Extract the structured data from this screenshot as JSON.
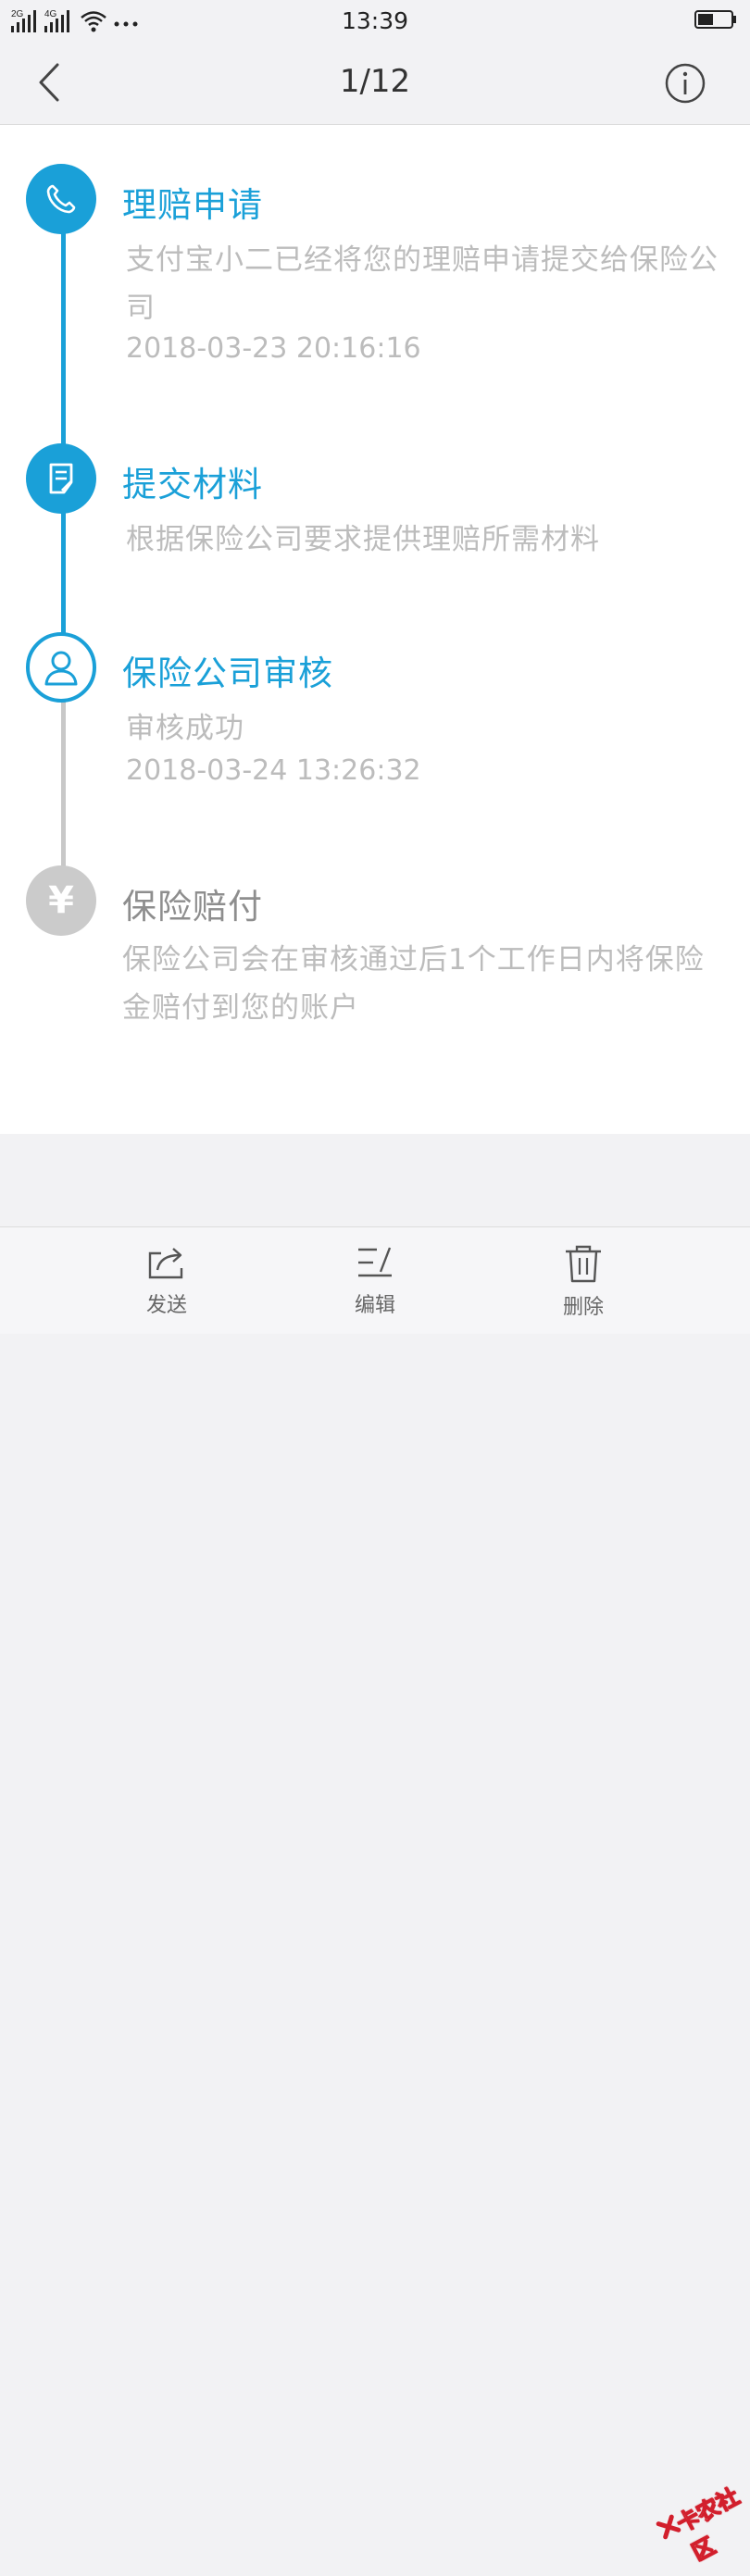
{
  "status_bar": {
    "time": "13:39",
    "network_1": "2G",
    "network_2": "4G"
  },
  "nav": {
    "title": "1/12"
  },
  "steps": [
    {
      "title": "理赔申请",
      "desc": "支付宝小二已经将您的理赔申请提交给保险公司",
      "time": "2018-03-23 20:16:16",
      "icon": "phone-icon",
      "state": "done"
    },
    {
      "title": "提交材料",
      "desc": "根据保险公司要求提供理赔所需材料",
      "time": "",
      "icon": "document-icon",
      "state": "done"
    },
    {
      "title": "保险公司审核",
      "desc": "审核成功",
      "time": "2018-03-24 13:26:32",
      "icon": "person-icon",
      "state": "current"
    },
    {
      "title": "保险赔付",
      "desc": "保险公司会在审核通过后1个工作日内将保险金赔付到您的账户",
      "time": "",
      "icon": "yen-icon",
      "state": "pending"
    }
  ],
  "toolbar": {
    "send_label": "发送",
    "edit_label": "编辑",
    "delete_label": "删除"
  },
  "watermark": {
    "text": "卡农社区"
  },
  "colors": {
    "accent": "#1aa0d8",
    "inactive": "#c8c8c8",
    "muted_text": "#bcbcbc"
  }
}
